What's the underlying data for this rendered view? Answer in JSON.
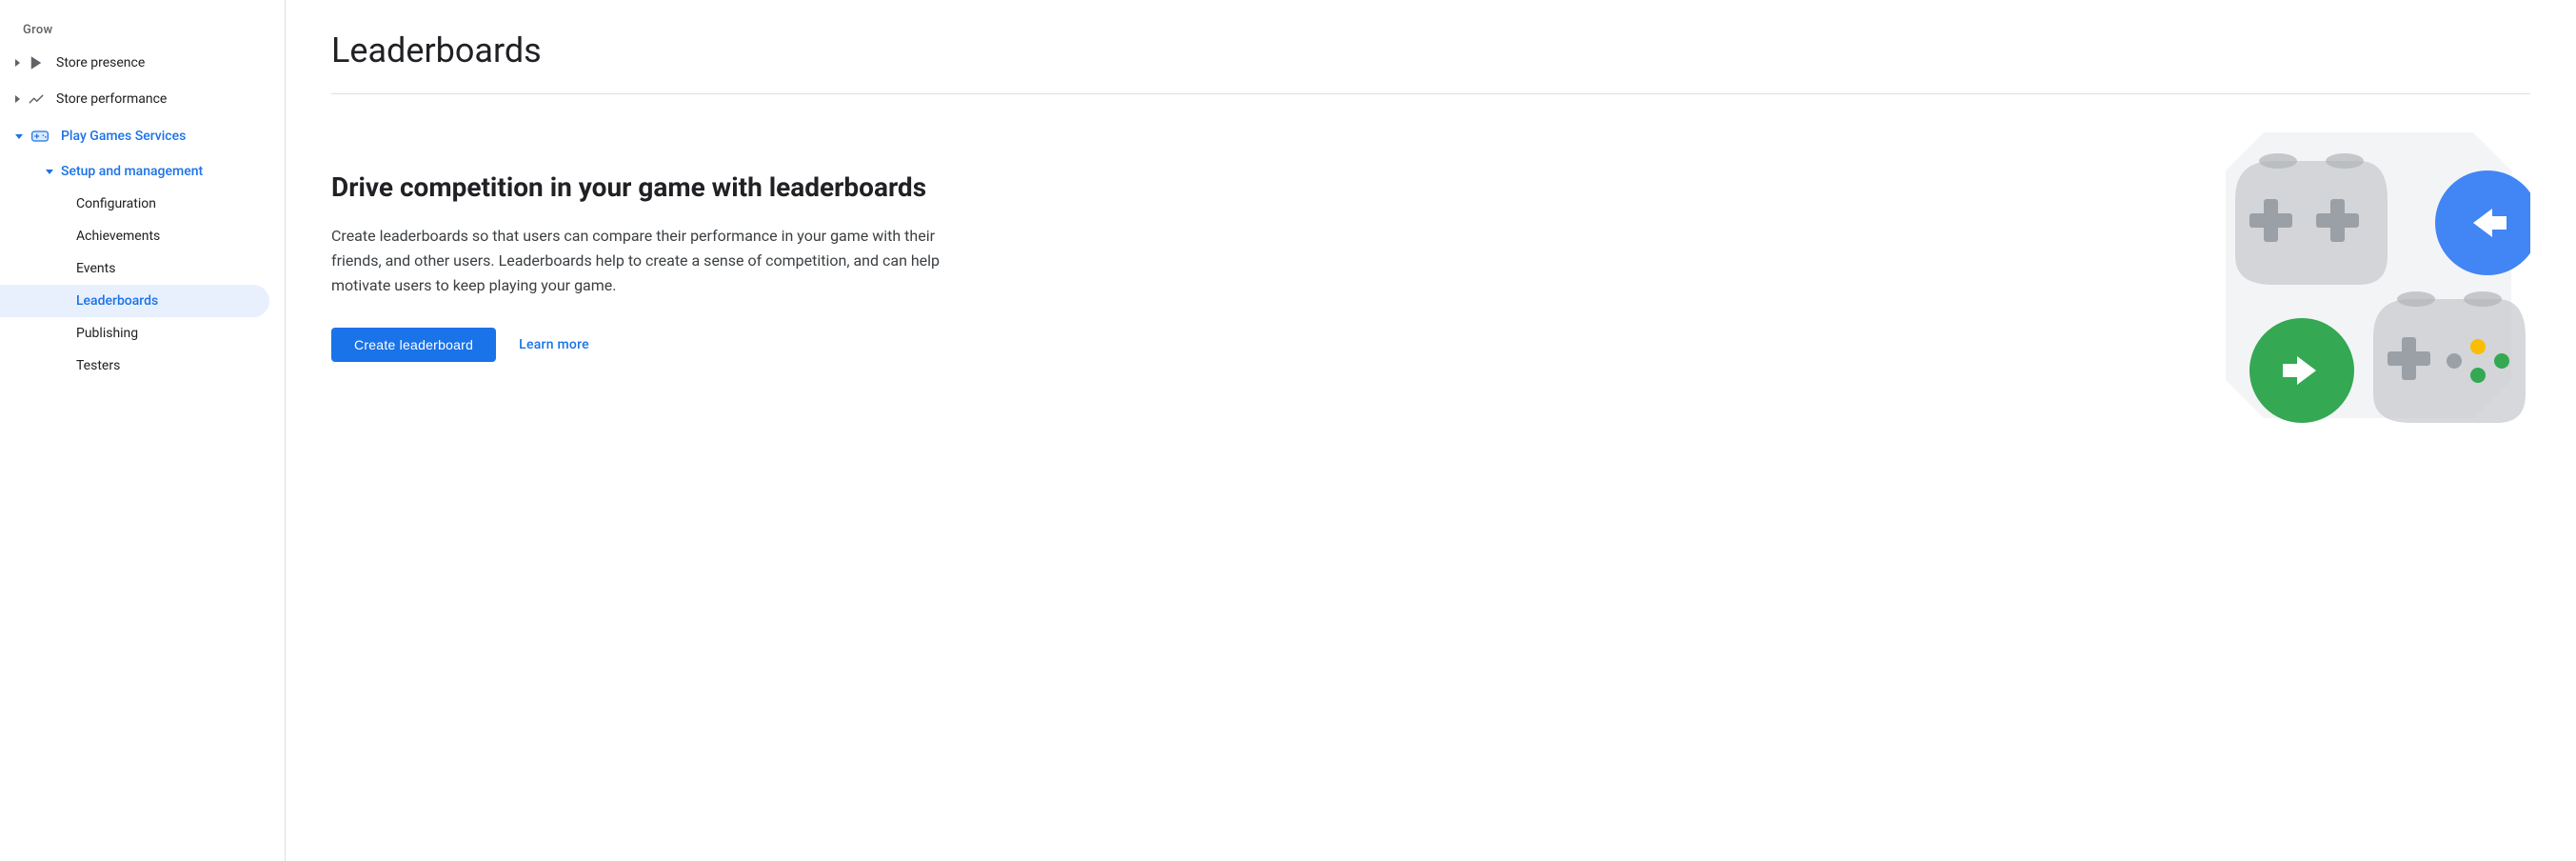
{
  "sidebar": {
    "grow_label": "Grow",
    "items": [
      {
        "id": "store-presence",
        "label": "Store presence",
        "icon": "play-icon",
        "expanded": false,
        "level": 1
      },
      {
        "id": "store-performance",
        "label": "Store performance",
        "icon": "trending-icon",
        "expanded": false,
        "level": 1
      },
      {
        "id": "play-games-services",
        "label": "Play Games Services",
        "icon": "gamepad-icon",
        "expanded": true,
        "active": true,
        "level": 1,
        "children": [
          {
            "id": "setup-management",
            "label": "Setup and management",
            "expanded": true,
            "active": true,
            "children": [
              {
                "id": "configuration",
                "label": "Configuration"
              },
              {
                "id": "achievements",
                "label": "Achievements"
              },
              {
                "id": "events",
                "label": "Events"
              },
              {
                "id": "leaderboards",
                "label": "Leaderboards",
                "active": true
              },
              {
                "id": "publishing",
                "label": "Publishing"
              },
              {
                "id": "testers",
                "label": "Testers"
              }
            ]
          }
        ]
      }
    ]
  },
  "main": {
    "title": "Leaderboards",
    "heading": "Drive competition in your game with leaderboards",
    "description": "Create leaderboards so that users can compare their performance in your game with their friends, and other users. Leaderboards help to create a sense of competition, and can help motivate users to keep playing your game.",
    "create_button": "Create leaderboard",
    "learn_more": "Learn more"
  },
  "colors": {
    "primary": "#1a73e8",
    "active_bg": "#e8f0fe",
    "text_primary": "#202124",
    "text_secondary": "#5f6368",
    "divider": "#e0e0e0"
  }
}
